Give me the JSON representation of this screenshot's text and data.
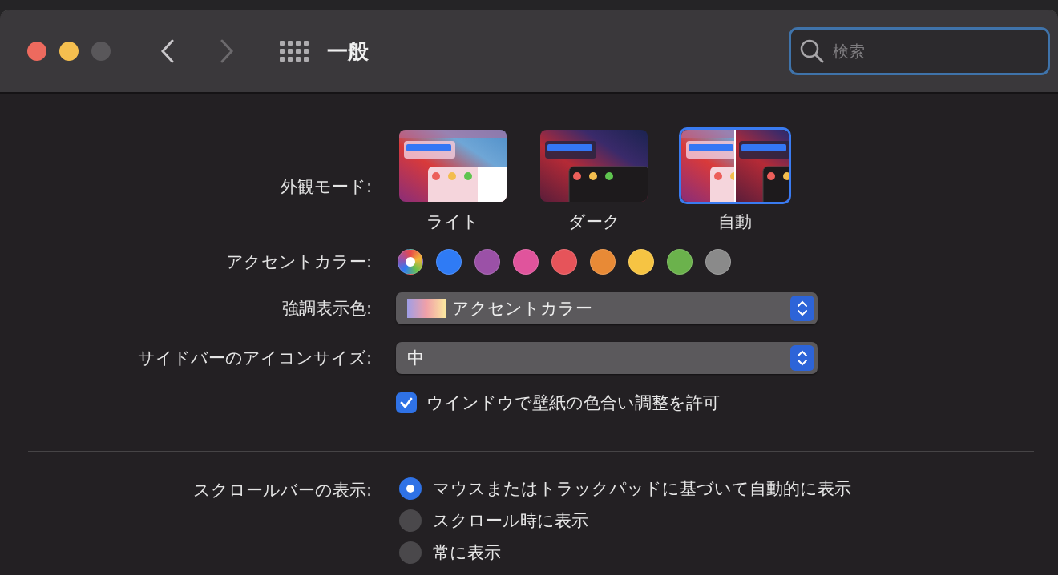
{
  "window": {
    "title": "一般"
  },
  "nav": [
    {
      "kind": "back",
      "disabled": false
    },
    {
      "kind": "forward",
      "disabled": true
    }
  ],
  "search": {
    "placeholder": "検索"
  },
  "appearance": {
    "label": "外観モード:",
    "options": [
      {
        "kind": "light",
        "label": "ライト",
        "selected": false
      },
      {
        "kind": "dark",
        "label": "ダーク",
        "selected": false
      },
      {
        "kind": "auto",
        "label": "自動",
        "selected": true
      }
    ]
  },
  "accent": {
    "label": "アクセントカラー:",
    "colors": [
      {
        "kind": "multicolor",
        "selected": true
      },
      {
        "kind": "solid",
        "color": "#2f7bf5",
        "selected": false
      },
      {
        "kind": "solid",
        "color": "#9b51a7",
        "selected": false
      },
      {
        "kind": "solid",
        "color": "#e0549c",
        "selected": false
      },
      {
        "kind": "solid",
        "color": "#e6545a",
        "selected": false
      },
      {
        "kind": "solid",
        "color": "#e88a36",
        "selected": false
      },
      {
        "kind": "solid",
        "color": "#f6c443",
        "selected": false
      },
      {
        "kind": "solid",
        "color": "#6bb24c",
        "selected": false
      },
      {
        "kind": "solid",
        "color": "#8a8a8a",
        "selected": false
      }
    ]
  },
  "popups": [
    {
      "label": "強調表示色:",
      "value": "アクセントカラー",
      "kind": "swatch"
    },
    {
      "label": "サイドバーのアイコンサイズ:",
      "value": "中",
      "kind": "plain"
    }
  ],
  "wallpaper_tinting": {
    "label": "ウインドウで壁紙の色合い調整を許可",
    "checked": true
  },
  "scroll_bars": {
    "label": "スクロールバーの表示:",
    "options": [
      {
        "label": "マウスまたはトラックパッドに基づいて自動的に表示",
        "selected": true
      },
      {
        "label": "スクロール時に表示",
        "selected": false
      },
      {
        "label": "常に表示",
        "selected": false
      }
    ]
  }
}
